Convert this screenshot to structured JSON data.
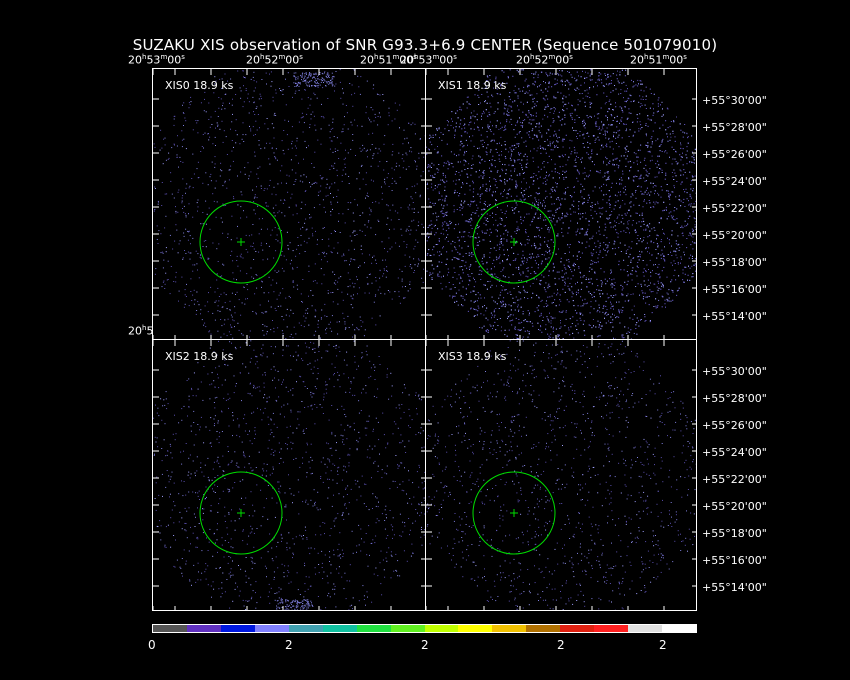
{
  "title": "SUZAKU XIS observation of SNR G93.3+6.9 CENTER  (Sequence 501079010)",
  "panels": [
    {
      "label": "XIS0 18.9 ks"
    },
    {
      "label": "XIS1 18.9 ks"
    },
    {
      "label": "XIS2 18.9 ks"
    },
    {
      "label": "XIS3 18.9 ks"
    }
  ],
  "ra_ticks": [
    "20h53m00s",
    "20h52m00s",
    "20h51m00s"
  ],
  "dec_ticks": [
    "+55°30'00\"",
    "+55°28'00\"",
    "+55°26'00\"",
    "+55°24'00\"",
    "+55°22'00\"",
    "+55°20'00\"",
    "+55°18'00\"",
    "+55°16'00\"",
    "+55°14'00\""
  ],
  "colorbar": {
    "colors": [
      "#555555",
      "#6030c0",
      "#0018e0",
      "#8080ff",
      "#40a0b0",
      "#10c0a0",
      "#20e040",
      "#60f020",
      "#c0ff00",
      "#ffff00",
      "#f0c000",
      "#b07000",
      "#e02010",
      "#ff2020",
      "#e0e0e0",
      "#ffffff"
    ],
    "labels": [
      "0",
      "2",
      "2",
      "2",
      "2"
    ]
  },
  "region_color": "#00dd00"
}
